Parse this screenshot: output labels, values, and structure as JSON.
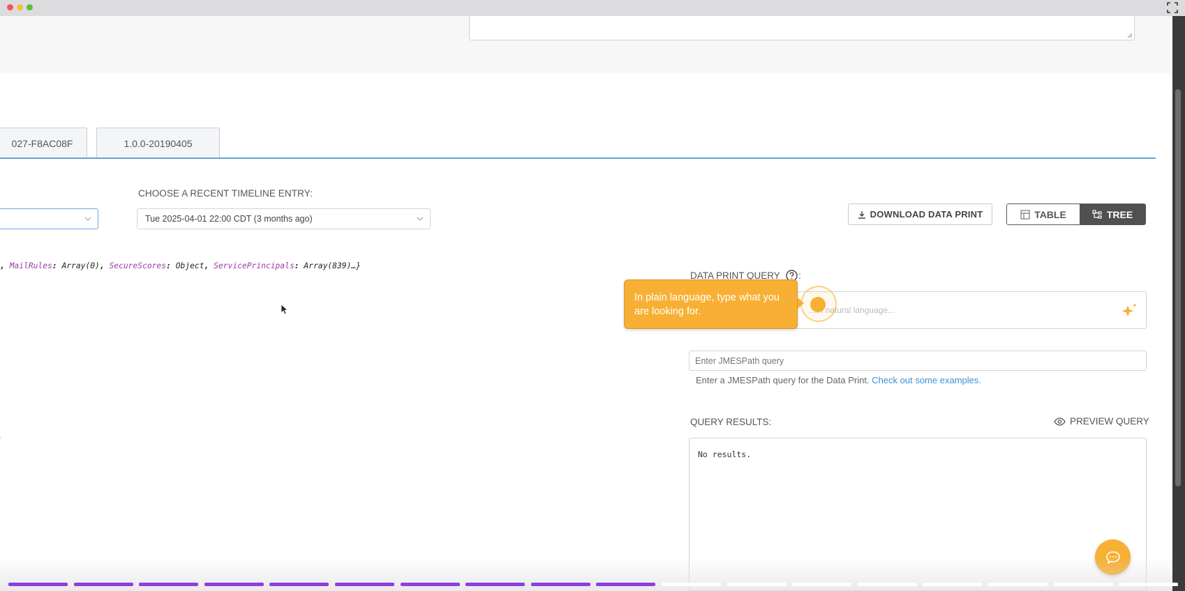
{
  "tabs": [
    {
      "label": "027-F8AC08F"
    },
    {
      "label": "1.0.0-20190405"
    }
  ],
  "timeline": {
    "label": "CHOOSE A RECENT TIMELINE ENTRY:",
    "selected": "Tue 2025-04-01 22:00 CDT (3 months ago)"
  },
  "toolbar": {
    "download_label": "DOWNLOAD DATA PRINT",
    "table_label": "TABLE",
    "tree_label": "TREE",
    "active_view": "TREE"
  },
  "tree_preview": {
    "prefix": ", ",
    "entries": [
      {
        "key": "MailRules",
        "value": "Array(0)"
      },
      {
        "key": "SecureScores",
        "value": "Object"
      },
      {
        "key": "ServicePrincipals",
        "value": "Array(839)…}"
      }
    ],
    "stray": ")"
  },
  "data_print_query": {
    "label": "DATA PRINT QUERY",
    "colon": ":",
    "nl_placeholder": "…in natural language..."
  },
  "tooltip": {
    "text": "In plain language, type what you are looking for."
  },
  "jmespath": {
    "placeholder": "Enter JMESPath query",
    "help_text": "Enter a JMESPath query for the Data Print. ",
    "help_link": "Check out some examples."
  },
  "query_results": {
    "label": "QUERY RESULTS:",
    "preview_label": "PREVIEW QUERY",
    "result_text": "No results."
  },
  "colors": {
    "accent_orange": "#f7b034",
    "link_blue": "#3c8fd1",
    "progress_done": "#8b3fe0",
    "progress_todo": "#ffffff"
  },
  "progress": {
    "total_segments": 18,
    "completed_segments": 10
  }
}
